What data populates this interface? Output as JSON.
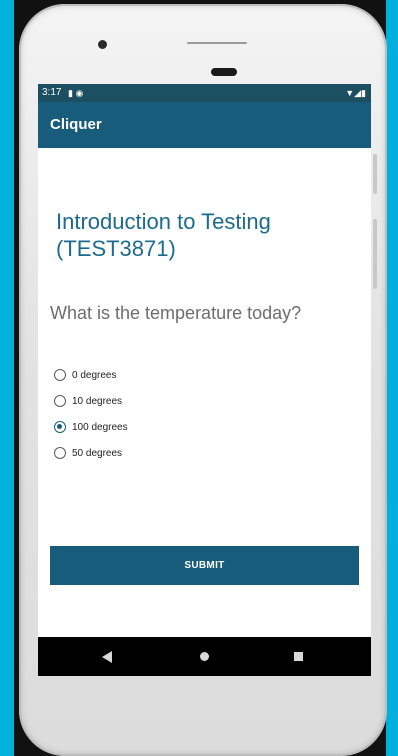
{
  "status_bar": {
    "time": "3:17",
    "left_icons": [
      "sim-icon",
      "data-saver-icon"
    ],
    "right_icons": [
      "wifi-icon",
      "signal-icon",
      "battery-icon"
    ]
  },
  "app_bar": {
    "title": "Cliquer"
  },
  "course": {
    "title_line1": "Introduction to Testing",
    "title_line2": "(TEST3871)"
  },
  "question": {
    "text": "What is the temperature today?"
  },
  "options": [
    {
      "label": "0 degrees",
      "selected": false
    },
    {
      "label": "10 degrees",
      "selected": false
    },
    {
      "label": "100 degrees",
      "selected": true
    },
    {
      "label": "50 degrees",
      "selected": false
    }
  ],
  "submit": {
    "label": "SUBMIT"
  },
  "colors": {
    "primary": "#175c7a",
    "status_bar": "#1d4f62",
    "course_title": "#1d6b8c",
    "background": "#00b0dc"
  }
}
